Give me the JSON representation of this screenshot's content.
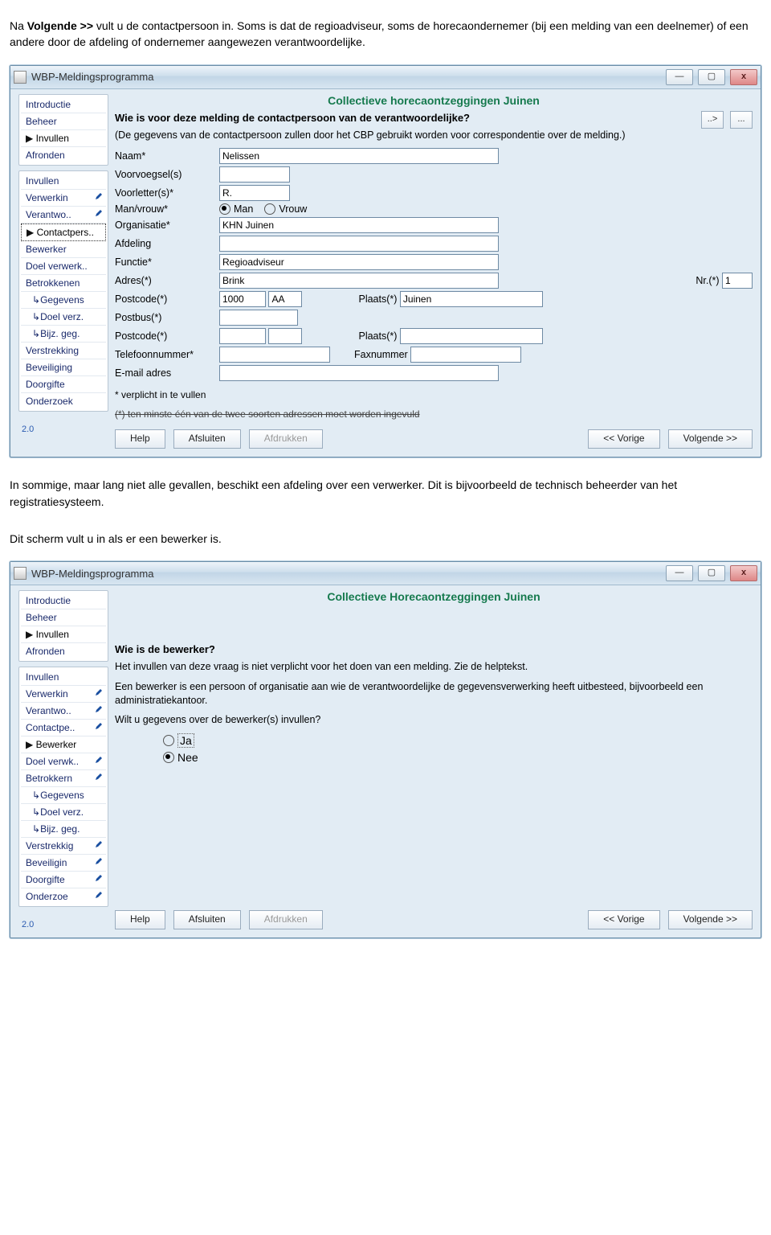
{
  "para1_a": "Na ",
  "para1_bold": "Volgende >> ",
  "para1_b": "vult u de contactpersoon in. Soms is dat de regioadviseur, soms de horecaondernemer (bij een melding van een deelnemer) of een andere door de afdeling of ondernemer aangewezen verantwoordelijke.",
  "para2": "In sommige, maar lang niet alle gevallen, beschikt een afdeling over een verwerker. Dit is bijvoorbeeld de technisch beheerder van het registratiesysteem.",
  "para3": "Dit scherm vult u in als er een bewerker is.",
  "app_title": "WBP-Meldingsprogramma",
  "winbtn_min": "—",
  "winbtn_max": "▢",
  "winbtn_close": "x",
  "version": "2.0",
  "nav_main": {
    "intro": "Introductie",
    "beheer": "Beheer",
    "invullen": "Invullen",
    "afronden": "Afronden"
  },
  "nav_sub": {
    "invullen": "Invullen",
    "verwerking": "Verwerkin",
    "verantwoord": "Verantwo",
    "contactpers": "Contactpers..",
    "contactpers2": "Contactpe",
    "bewerker": "Bewerker",
    "doelverwerk": "Doel verwerk..",
    "doelverwerk2": "Doel verw",
    "betrokkenen": "Betrokkenen",
    "betrokkenen2": "Betrokker",
    "gegevens": "Gegevens",
    "doelverz": "Doel verz.",
    "bijzgeg": "Bijz. geg.",
    "verstrekking": "Verstrekking",
    "verstrekking2": "Verstrekki",
    "beveiliging": "Beveiliging",
    "beveiliging2": "Beveiligin",
    "doorgifte": "Doorgifte",
    "onderzoek": "Onderzoek",
    "onderzoek2": "Onderzoe"
  },
  "win1": {
    "title": "Collectieve horecaontzeggingen Juinen",
    "question": "Wie is voor deze melding de contactpersoon van de verantwoordelijke?",
    "headbtn1": "..>",
    "headbtn2": "...",
    "expl": "(De gegevens van de contactpersoon zullen door het CBP gebruikt worden voor correspondentie over de melding.)",
    "labels": {
      "naam": "Naam*",
      "voorvoegsel": "Voorvoegsel(s)",
      "voorletters": "Voorletter(s)*",
      "manvrouw": "Man/vrouw*",
      "man": "Man",
      "vrouw": "Vrouw",
      "organisatie": "Organisatie*",
      "afdeling": "Afdeling",
      "functie": "Functie*",
      "adres": "Adres(*)",
      "nr": "Nr.(*)",
      "postcode": "Postcode(*)",
      "plaats": "Plaats(*)",
      "postbus": "Postbus(*)",
      "telefoon": "Telefoonnummer*",
      "fax": "Faxnummer",
      "email": "E-mail adres"
    },
    "values": {
      "naam": "Nelissen",
      "voorletters": "R.",
      "organisatie": "KHN Juinen",
      "functie": "Regioadviseur",
      "adres": "Brink",
      "nr": "1",
      "postcode1": "1000",
      "postcode2": "AA",
      "plaats": "Juinen"
    },
    "note1": "* verplicht in te vullen",
    "note2": "(*) ten minste één van de twee soorten adressen moet worden ingevuld"
  },
  "win2": {
    "title": "Collectieve Horecaontzeggingen Juinen",
    "question": "Wie is de bewerker?",
    "expl1": "Het invullen van deze vraag is niet verplicht voor het doen van een melding. Zie de helptekst.",
    "expl2": "Een bewerker is een persoon of organisatie aan wie de verantwoordelijke de gegevensverwerking heeft uitbesteed, bijvoorbeeld een administratiekantoor.",
    "expl3": "Wilt u gegevens over de bewerker(s) invullen?",
    "ja": "Ja",
    "nee": "Nee"
  },
  "btns": {
    "help": "Help",
    "afsluiten": "Afsluiten",
    "afdrukken": "Afdrukken",
    "vorige": "<< Vorige",
    "volgende": "Volgende >>"
  }
}
